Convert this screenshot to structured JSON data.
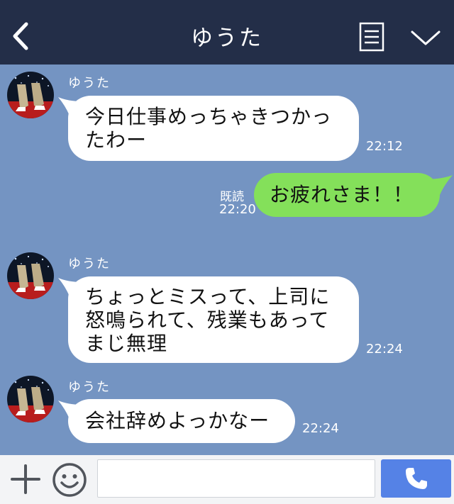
{
  "header": {
    "title": "ゆうた",
    "back_icon": "chevron-left-icon",
    "menu_icon": "document-menu-icon",
    "down_icon": "chevron-down-icon"
  },
  "messages": [
    {
      "direction": "in",
      "sender": "ゆうた",
      "lines": [
        "今日仕事めっちゃきつかっ",
        "たわー"
      ],
      "time": "22:12"
    },
    {
      "direction": "out",
      "lines": [
        "お疲れさま！！"
      ],
      "read": "既読",
      "time": "22:20"
    },
    {
      "direction": "in",
      "sender": "ゆうた",
      "lines": [
        "ちょっとミスって、上司に",
        "怒鳴られて、残業もあって",
        "まじ無理"
      ],
      "time": "22:24"
    },
    {
      "direction": "in",
      "sender": "ゆうた",
      "lines": [
        "会社辞めよっかなー"
      ],
      "time": "22:24"
    }
  ],
  "footer": {
    "input_value": "",
    "plus_icon": "plus-icon",
    "emoji_icon": "smiley-icon",
    "call_icon": "phone-icon"
  },
  "colors": {
    "header_bg": "#232e48",
    "chat_bg": "#7494c2",
    "incoming_bubble": "#ffffff",
    "outgoing_bubble": "#84e05a",
    "call_button": "#5582e6"
  }
}
